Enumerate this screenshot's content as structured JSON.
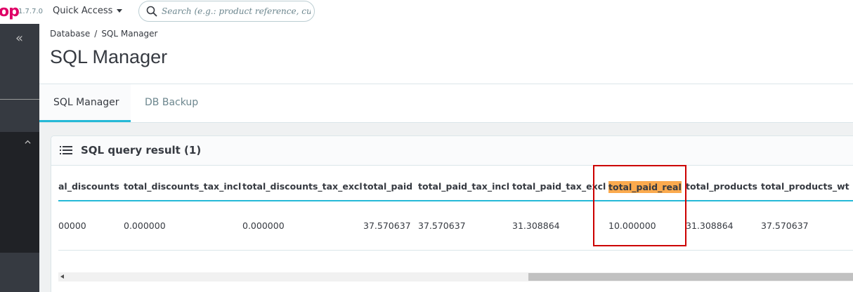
{
  "topbar": {
    "logo_fragment": "op",
    "version": "1.7.7.0",
    "quick_access": "Quick Access",
    "search_placeholder": "Search (e.g.: product reference, customer"
  },
  "header": {
    "breadcrumb": [
      "Database",
      "/",
      "SQL Manager"
    ],
    "title": "SQL Manager"
  },
  "tabs": [
    {
      "label": "SQL Manager",
      "active": true
    },
    {
      "label": "DB Backup",
      "active": false
    }
  ],
  "panel": {
    "title": "SQL query result (1)"
  },
  "table": {
    "columns": [
      "al_discounts",
      "total_discounts_tax_incl",
      "total_discounts_tax_excl",
      "total_paid",
      "total_paid_tax_incl",
      "total_paid_tax_excl",
      "total_paid_real",
      "total_products",
      "total_products_wt"
    ],
    "row": [
      "00000",
      "0.000000",
      "0.000000",
      "37.570637",
      "37.570637",
      "31.308864",
      "10.000000",
      "31.308864",
      "37.570637"
    ],
    "highlighted_column": "total_paid_real"
  },
  "colors": {
    "accent": "#25b9d7",
    "highlight": "#fbaa4e",
    "annotation_box": "#cc0000",
    "sidebar": "#363a41"
  }
}
